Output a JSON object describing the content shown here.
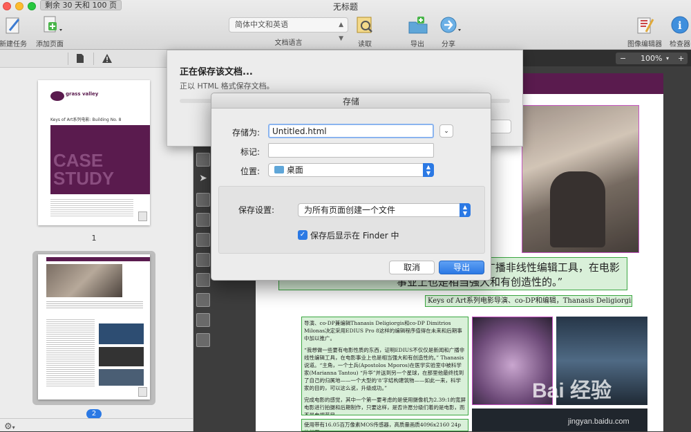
{
  "window": {
    "title": "无标题",
    "trial_badge": "剩余 30 天和 100 页"
  },
  "toolbar": {
    "items": [
      {
        "label": "新建任务",
        "icon": "new-task-icon"
      },
      {
        "label": "添加页面",
        "icon": "add-page-icon"
      },
      {
        "label": "读取",
        "icon": "read-icon"
      },
      {
        "label": "导出",
        "icon": "export-icon"
      },
      {
        "label": "分享",
        "icon": "share-icon"
      },
      {
        "label": "图像编辑器",
        "icon": "image-editor-icon"
      },
      {
        "label": "检查器",
        "icon": "inspector-icon"
      }
    ],
    "language": {
      "value": "简体中文和英语",
      "label": "文档语言"
    }
  },
  "sidebar": {
    "pages": [
      {
        "number": "1",
        "company": "grass valley",
        "heading": "Keys of Art系列电影: Building No. 8",
        "banner": "CASE STUDY"
      },
      {
        "number": "2"
      }
    ]
  },
  "viewer": {
    "zoom": "100%",
    "zoom_out": "−",
    "zoom_in": "+"
  },
  "document": {
    "quote": "US不仅仅是新闻和广播非线性编辑工具，在电影事业上也是相当强大和有创造性的。”",
    "credit": "Keys of Art系列电影导演、co-DP和编辑，Thanasis Deligiorgis",
    "para1": "导演、co-DP兼编辑Thanasis Deligiorgis和co-DP Dimitrios Milonas决定采用EDIUS Pro 8这样的编辑程序值得在未来和后期事中加以推广。",
    "para2": "“我想做一些要有电影性质的东西，证明EDIUS不仅仅是新闻和广播非线性编辑工具，在电影事业上也是相当强大和有创造性的。” Thanasis说道。“主角，一个士兵(Apostolos Mporos)在医学实验室中被科学家(Marianna Tantou) “升华”并送到另一个星球，在那里他最终找到了自己的归属地——一个大型的‘8’字结构建筑物——如此一来，科学家的目的，可以这么说，升级成功。”",
    "para3": "完成电影的感觉，其中一个第一要考虑的是使用摄像机为2.39:1的宽屏电影进行拍摄和后期制作，只要这样，是否许愿分级们着的是电影，而不是电视节目。",
    "para4": "使用带有16.05百万像素MOS传感器，高质量画质4096x2160 24p的松下"
  },
  "saving_sheet": {
    "title": "正在保存该文档...",
    "subtitle": "正以 HTML 格式保存文档。"
  },
  "save_dialog": {
    "title": "存储",
    "save_as_label": "存储为:",
    "filename": "Untitled.html",
    "tags_label": "标记:",
    "tags_value": "",
    "location_label": "位置:",
    "location_value": "桌面",
    "settings_label": "保存设置:",
    "settings_value": "为所有页面创建一个文件",
    "show_in_finder": "保存后显示在 Finder 中",
    "show_in_finder_checked": true,
    "cancel": "取消",
    "export": "导出"
  },
  "watermark": {
    "brand": "Bai 经验",
    "url": "jingyan.baidu.com"
  },
  "colors": {
    "accent": "#2b79e4",
    "brand_purple": "#5a1b4e",
    "region_green": "#3aa640",
    "region_magenta": "#c44ec0"
  }
}
